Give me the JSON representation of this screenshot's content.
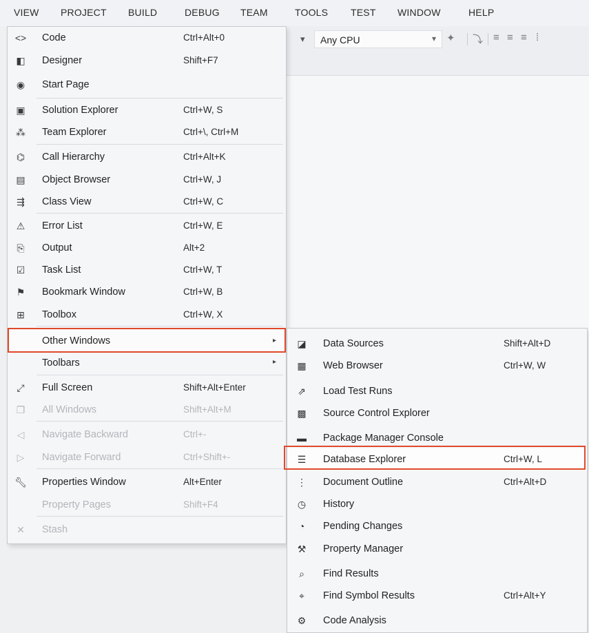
{
  "menubar": {
    "items": [
      "VIEW",
      "PROJECT",
      "BUILD",
      "DEBUG",
      "TEAM",
      "TOOLS",
      "TEST",
      "WINDOW",
      "HELP"
    ]
  },
  "toolbar": {
    "platform_value": "Any CPU"
  },
  "view_menu": {
    "items": [
      {
        "icon": "code-icon",
        "label": "Code",
        "shortcut": "Ctrl+Alt+0"
      },
      {
        "icon": "designer-icon",
        "label": "Designer",
        "shortcut": "Shift+F7"
      },
      {
        "icon": "start-page-icon",
        "label": "Start Page",
        "shortcut": ""
      },
      {
        "icon": "solution-explorer-icon",
        "label": "Solution Explorer",
        "shortcut": "Ctrl+W, S"
      },
      {
        "icon": "team-explorer-icon",
        "label": "Team Explorer",
        "shortcut": "Ctrl+\\, Ctrl+M"
      },
      {
        "icon": "call-hierarchy-icon",
        "label": "Call Hierarchy",
        "shortcut": "Ctrl+Alt+K"
      },
      {
        "icon": "object-browser-icon",
        "label": "Object Browser",
        "shortcut": "Ctrl+W, J"
      },
      {
        "icon": "class-view-icon",
        "label": "Class View",
        "shortcut": "Ctrl+W, C"
      },
      {
        "icon": "error-list-icon",
        "label": "Error List",
        "shortcut": "Ctrl+W, E"
      },
      {
        "icon": "output-icon",
        "label": "Output",
        "shortcut": "Alt+2"
      },
      {
        "icon": "task-list-icon",
        "label": "Task List",
        "shortcut": "Ctrl+W, T"
      },
      {
        "icon": "bookmark-icon",
        "label": "Bookmark Window",
        "shortcut": "Ctrl+W, B"
      },
      {
        "icon": "toolbox-icon",
        "label": "Toolbox",
        "shortcut": "Ctrl+W, X"
      },
      {
        "icon": "",
        "label": "Other Windows",
        "shortcut": ""
      },
      {
        "icon": "",
        "label": "Toolbars",
        "shortcut": ""
      },
      {
        "icon": "full-screen-icon",
        "label": "Full Screen",
        "shortcut": "Shift+Alt+Enter"
      },
      {
        "icon": "all-windows-icon",
        "label": "All Windows",
        "shortcut": "Shift+Alt+M"
      },
      {
        "icon": "navigate-backward-icon",
        "label": "Navigate Backward",
        "shortcut": "Ctrl+-"
      },
      {
        "icon": "navigate-forward-icon",
        "label": "Navigate Forward",
        "shortcut": "Ctrl+Shift+-"
      },
      {
        "icon": "properties-icon",
        "label": "Properties Window",
        "shortcut": "Alt+Enter"
      },
      {
        "icon": "",
        "label": "Property Pages",
        "shortcut": "Shift+F4"
      },
      {
        "icon": "stash-icon",
        "label": "Stash",
        "shortcut": ""
      }
    ]
  },
  "other_windows_menu": {
    "items": [
      {
        "icon": "data-sources-icon",
        "label": "Data Sources",
        "shortcut": "Shift+Alt+D"
      },
      {
        "icon": "web-browser-icon",
        "label": "Web Browser",
        "shortcut": "Ctrl+W, W"
      },
      {
        "icon": "load-test-runs-icon",
        "label": "Load Test Runs",
        "shortcut": ""
      },
      {
        "icon": "source-control-explorer-icon",
        "label": "Source Control Explorer",
        "shortcut": ""
      },
      {
        "icon": "package-manager-console-icon",
        "label": "Package Manager Console",
        "shortcut": ""
      },
      {
        "icon": "database-explorer-icon",
        "label": "Database Explorer",
        "shortcut": "Ctrl+W, L"
      },
      {
        "icon": "document-outline-icon",
        "label": "Document Outline",
        "shortcut": "Ctrl+Alt+D"
      },
      {
        "icon": "history-icon",
        "label": "History",
        "shortcut": ""
      },
      {
        "icon": "pending-changes-icon",
        "label": "Pending Changes",
        "shortcut": ""
      },
      {
        "icon": "property-manager-icon",
        "label": "Property Manager",
        "shortcut": ""
      },
      {
        "icon": "find-results-icon",
        "label": "Find Results",
        "shortcut": ""
      },
      {
        "icon": "find-symbol-results-icon",
        "label": "Find Symbol Results",
        "shortcut": "Ctrl+Alt+Y"
      },
      {
        "icon": "code-analysis-icon",
        "label": "Code Analysis",
        "shortcut": ""
      }
    ]
  },
  "colors": {
    "highlight_border": "#e0482a",
    "menu_background": "#f5f6f8"
  }
}
